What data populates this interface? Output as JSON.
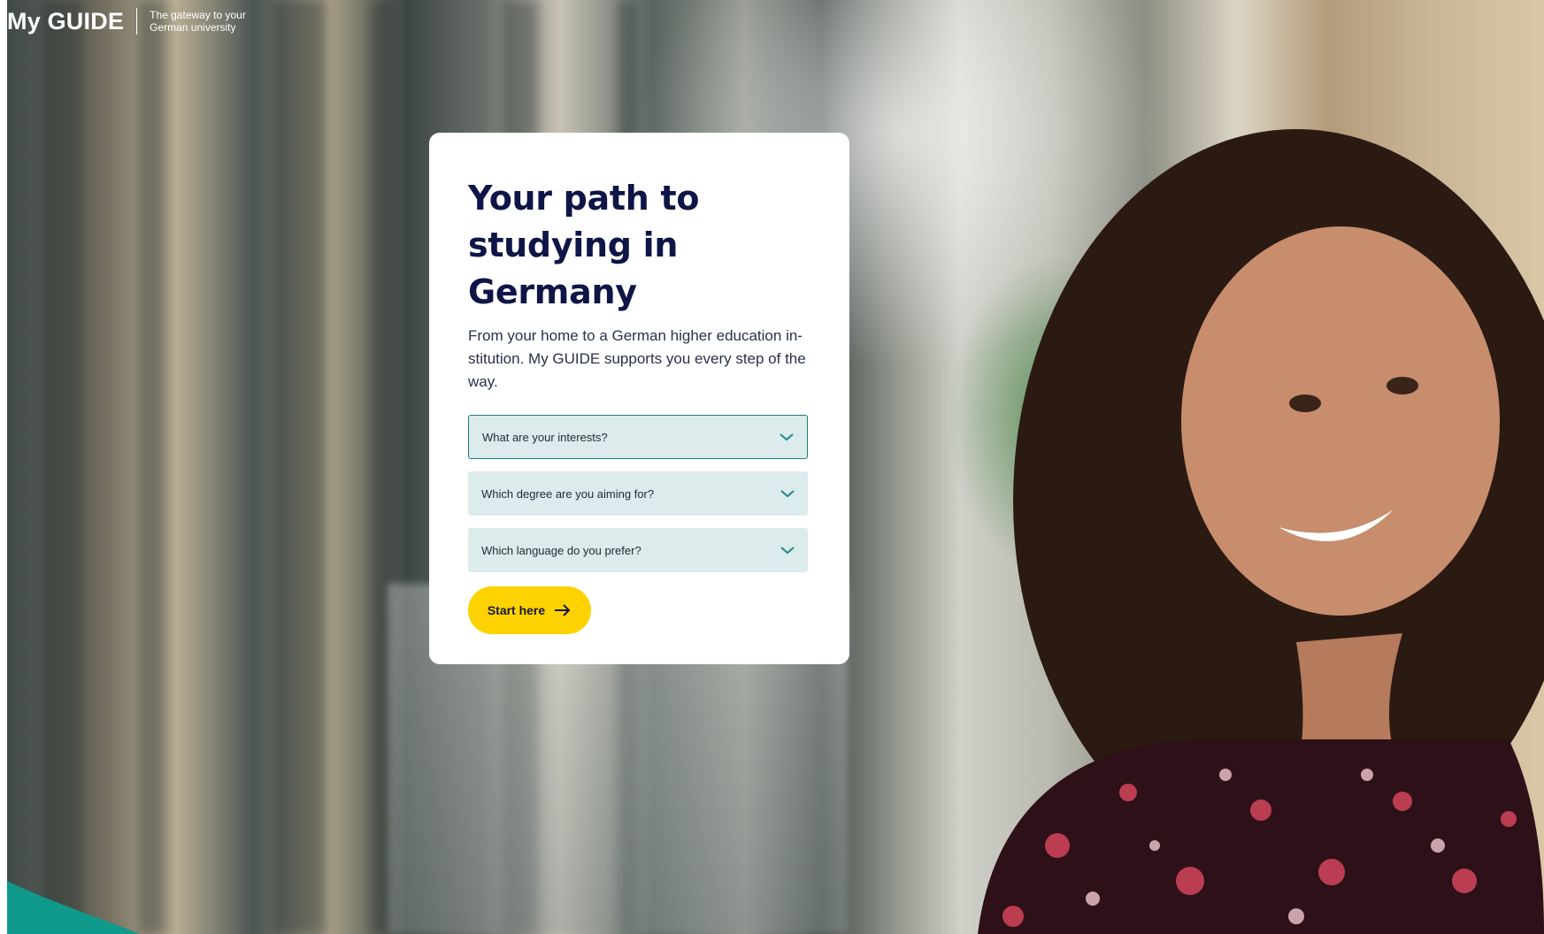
{
  "header": {
    "logo_text": "My GUIDE",
    "tagline_line1": "The gateway to your",
    "tagline_line2": "German university"
  },
  "hero": {
    "title_line1": "Your path to",
    "title_line2": "studying in",
    "title_line3": "Germany",
    "subtitle": "From your home to a German higher education in-stitution. My GUIDE supports you every step of the way."
  },
  "filters": [
    {
      "label": "What are your interests?",
      "icon": "chevron-down-icon"
    },
    {
      "label": "Which degree are you aiming for?",
      "icon": "chevron-down-icon"
    },
    {
      "label": "Which language do you prefer?",
      "icon": "chevron-down-icon"
    }
  ],
  "cta": {
    "label": "Start here",
    "icon": "arrow-right-icon"
  },
  "colors": {
    "title": "#0f1546",
    "dropdown_bg": "#dcebeb",
    "dropdown_focus_border": "#1f7c7c",
    "chevron": "#1f8a8a",
    "cta_bg": "#fed200",
    "teal_accent": "#0f9a8c"
  }
}
